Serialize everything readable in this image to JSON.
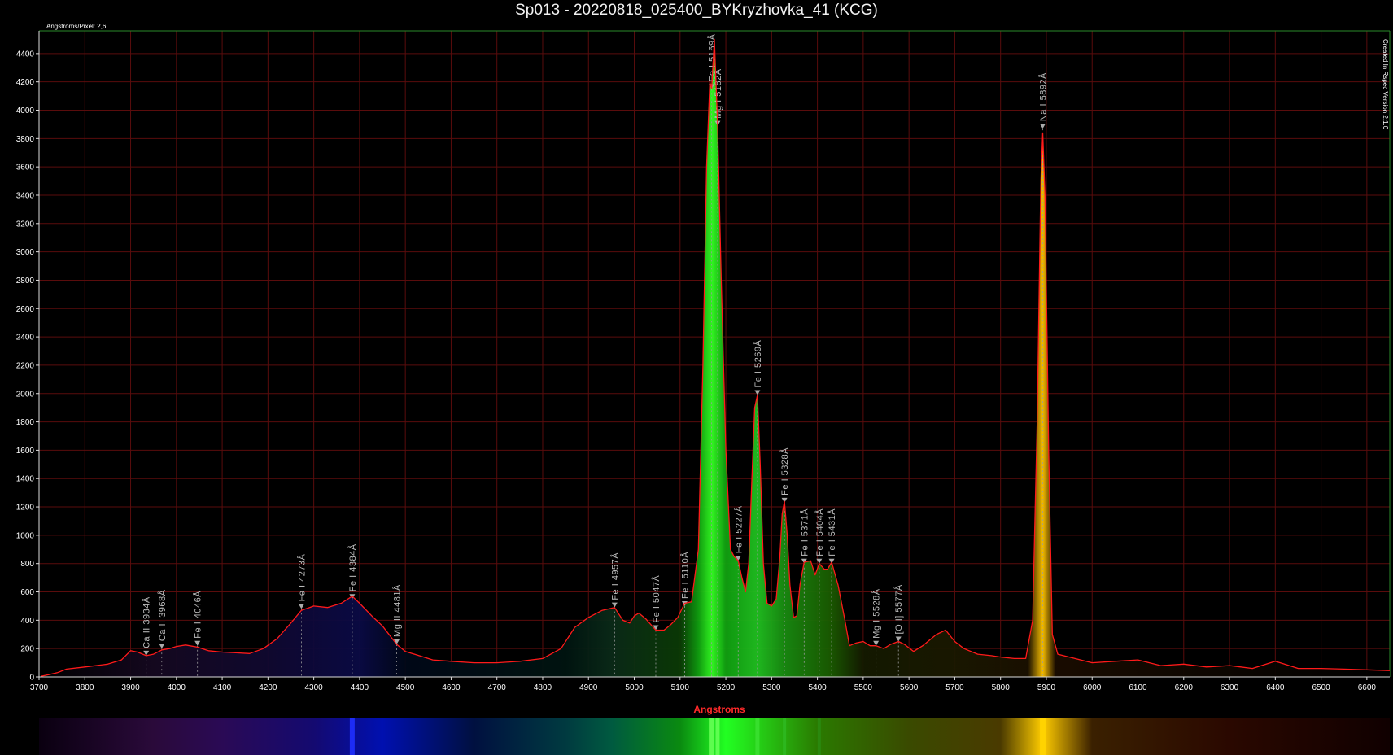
{
  "title": "Sp013 - 20220818_025400_BYKryzhovka_41 (KCG)",
  "dispersion_label": "Angstroms/Pixel: 2,6",
  "side_note": "Created In Rspec Version 2.1.0",
  "colors": {
    "background": "#000000",
    "grid": "#5a0c0c",
    "curve": "#ff1a1a",
    "xlabel": "#ff2a2a"
  },
  "chart_data": {
    "type": "line",
    "title": "Sp013 - 20220818_025400_BYKryzhovka_41 (KCG)",
    "xlabel": "Angstroms",
    "ylabel": "",
    "xlim": [
      3700,
      6650
    ],
    "ylim": [
      0,
      4560
    ],
    "grid": true,
    "x_ticks": [
      3700,
      3800,
      3900,
      4000,
      4100,
      4200,
      4300,
      4400,
      4500,
      4600,
      4700,
      4800,
      4900,
      5000,
      5100,
      5200,
      5300,
      5400,
      5500,
      5600,
      5700,
      5800,
      5900,
      6000,
      6100,
      6200,
      6300,
      6400,
      6500,
      6600
    ],
    "y_ticks": [
      0,
      200,
      400,
      600,
      800,
      1000,
      1200,
      1400,
      1600,
      1800,
      2000,
      2200,
      2400,
      2600,
      2800,
      3000,
      3200,
      3400,
      3600,
      3800,
      4000,
      4200,
      4400
    ],
    "series": [
      {
        "values": [
          [
            3705,
            5
          ],
          [
            3720,
            15
          ],
          [
            3740,
            30
          ],
          [
            3760,
            55
          ],
          [
            3800,
            70
          ],
          [
            3850,
            90
          ],
          [
            3880,
            120
          ],
          [
            3900,
            185
          ],
          [
            3915,
            175
          ],
          [
            3934,
            150
          ],
          [
            3950,
            160
          ],
          [
            3968,
            190
          ],
          [
            3985,
            200
          ],
          [
            4000,
            215
          ],
          [
            4020,
            225
          ],
          [
            4046,
            210
          ],
          [
            4070,
            185
          ],
          [
            4100,
            175
          ],
          [
            4130,
            170
          ],
          [
            4160,
            165
          ],
          [
            4190,
            200
          ],
          [
            4220,
            270
          ],
          [
            4250,
            380
          ],
          [
            4273,
            470
          ],
          [
            4300,
            500
          ],
          [
            4330,
            490
          ],
          [
            4360,
            520
          ],
          [
            4384,
            570
          ],
          [
            4400,
            520
          ],
          [
            4430,
            420
          ],
          [
            4450,
            360
          ],
          [
            4481,
            230
          ],
          [
            4500,
            180
          ],
          [
            4530,
            150
          ],
          [
            4560,
            120
          ],
          [
            4600,
            110
          ],
          [
            4650,
            100
          ],
          [
            4700,
            100
          ],
          [
            4750,
            110
          ],
          [
            4800,
            130
          ],
          [
            4840,
            200
          ],
          [
            4870,
            350
          ],
          [
            4900,
            420
          ],
          [
            4930,
            470
          ],
          [
            4957,
            490
          ],
          [
            4975,
            400
          ],
          [
            4990,
            380
          ],
          [
            5000,
            430
          ],
          [
            5010,
            450
          ],
          [
            5025,
            410
          ],
          [
            5047,
            330
          ],
          [
            5065,
            330
          ],
          [
            5080,
            370
          ],
          [
            5095,
            420
          ],
          [
            5110,
            520
          ],
          [
            5125,
            530
          ],
          [
            5140,
            900
          ],
          [
            5150,
            2200
          ],
          [
            5158,
            3600
          ],
          [
            5165,
            4200
          ],
          [
            5169,
            4150
          ],
          [
            5175,
            4500
          ],
          [
            5182,
            3900
          ],
          [
            5190,
            2800
          ],
          [
            5200,
            1600
          ],
          [
            5210,
            900
          ],
          [
            5218,
            850
          ],
          [
            5227,
            820
          ],
          [
            5235,
            700
          ],
          [
            5243,
            600
          ],
          [
            5250,
            800
          ],
          [
            5257,
            1400
          ],
          [
            5263,
            1900
          ],
          [
            5269,
            1990
          ],
          [
            5275,
            1500
          ],
          [
            5282,
            800
          ],
          [
            5290,
            520
          ],
          [
            5300,
            500
          ],
          [
            5310,
            550
          ],
          [
            5318,
            850
          ],
          [
            5323,
            1150
          ],
          [
            5328,
            1240
          ],
          [
            5334,
            1000
          ],
          [
            5340,
            650
          ],
          [
            5348,
            420
          ],
          [
            5355,
            430
          ],
          [
            5362,
            650
          ],
          [
            5371,
            810
          ],
          [
            5385,
            820
          ],
          [
            5395,
            720
          ],
          [
            5404,
            800
          ],
          [
            5415,
            760
          ],
          [
            5422,
            760
          ],
          [
            5431,
            810
          ],
          [
            5445,
            650
          ],
          [
            5460,
            400
          ],
          [
            5470,
            220
          ],
          [
            5485,
            240
          ],
          [
            5500,
            250
          ],
          [
            5515,
            220
          ],
          [
            5528,
            220
          ],
          [
            5545,
            200
          ],
          [
            5560,
            230
          ],
          [
            5577,
            250
          ],
          [
            5590,
            230
          ],
          [
            5610,
            180
          ],
          [
            5630,
            220
          ],
          [
            5660,
            300
          ],
          [
            5680,
            330
          ],
          [
            5700,
            250
          ],
          [
            5720,
            200
          ],
          [
            5750,
            160
          ],
          [
            5780,
            150
          ],
          [
            5800,
            140
          ],
          [
            5830,
            130
          ],
          [
            5855,
            130
          ],
          [
            5870,
            400
          ],
          [
            5880,
            1800
          ],
          [
            5888,
            3500
          ],
          [
            5892,
            3840
          ],
          [
            5897,
            3400
          ],
          [
            5905,
            1600
          ],
          [
            5913,
            300
          ],
          [
            5925,
            160
          ],
          [
            5950,
            140
          ],
          [
            6000,
            100
          ],
          [
            6050,
            110
          ],
          [
            6100,
            120
          ],
          [
            6150,
            80
          ],
          [
            6200,
            90
          ],
          [
            6250,
            70
          ],
          [
            6300,
            80
          ],
          [
            6350,
            60
          ],
          [
            6400,
            110
          ],
          [
            6420,
            90
          ],
          [
            6450,
            60
          ],
          [
            6500,
            60
          ],
          [
            6550,
            55
          ],
          [
            6600,
            50
          ],
          [
            6650,
            45
          ]
        ]
      }
    ],
    "lines": [
      {
        "label": "Ca II 3934Å",
        "x": 3934,
        "y": 150
      },
      {
        "label": "Ca II 3968Å",
        "x": 3968,
        "y": 200
      },
      {
        "label": "Fe I 4046Å",
        "x": 4046,
        "y": 220
      },
      {
        "label": "Fe I 4273Å",
        "x": 4273,
        "y": 480
      },
      {
        "label": "Fe I 4384Å",
        "x": 4384,
        "y": 550
      },
      {
        "label": "Mg II 4481Å",
        "x": 4481,
        "y": 230
      },
      {
        "label": "Fe I 4957Å",
        "x": 4957,
        "y": 490
      },
      {
        "label": "Fe I 5047Å",
        "x": 5047,
        "y": 330
      },
      {
        "label": "Fe I 5110Å",
        "x": 5110,
        "y": 500
      },
      {
        "label": "Fe I 5169Å",
        "x": 5169,
        "y": 4150
      },
      {
        "label": "Mg I 5182Å",
        "x": 5182,
        "y": 3890
      },
      {
        "label": "Fe I 5227Å",
        "x": 5227,
        "y": 820
      },
      {
        "label": "Fe I 5269Å",
        "x": 5269,
        "y": 1990
      },
      {
        "label": "Fe I 5328Å",
        "x": 5328,
        "y": 1230
      },
      {
        "label": "Fe I 5371Å",
        "x": 5371,
        "y": 800
      },
      {
        "label": "Fe I 5404Å",
        "x": 5404,
        "y": 800
      },
      {
        "label": "Fe I 5431Å",
        "x": 5431,
        "y": 800
      },
      {
        "label": "Mg I 5528Å",
        "x": 5528,
        "y": 220
      },
      {
        "label": "[O I] 5577Å",
        "x": 5577,
        "y": 250
      },
      {
        "label": "Na I 5892Å",
        "x": 5892,
        "y": 3870
      }
    ]
  }
}
